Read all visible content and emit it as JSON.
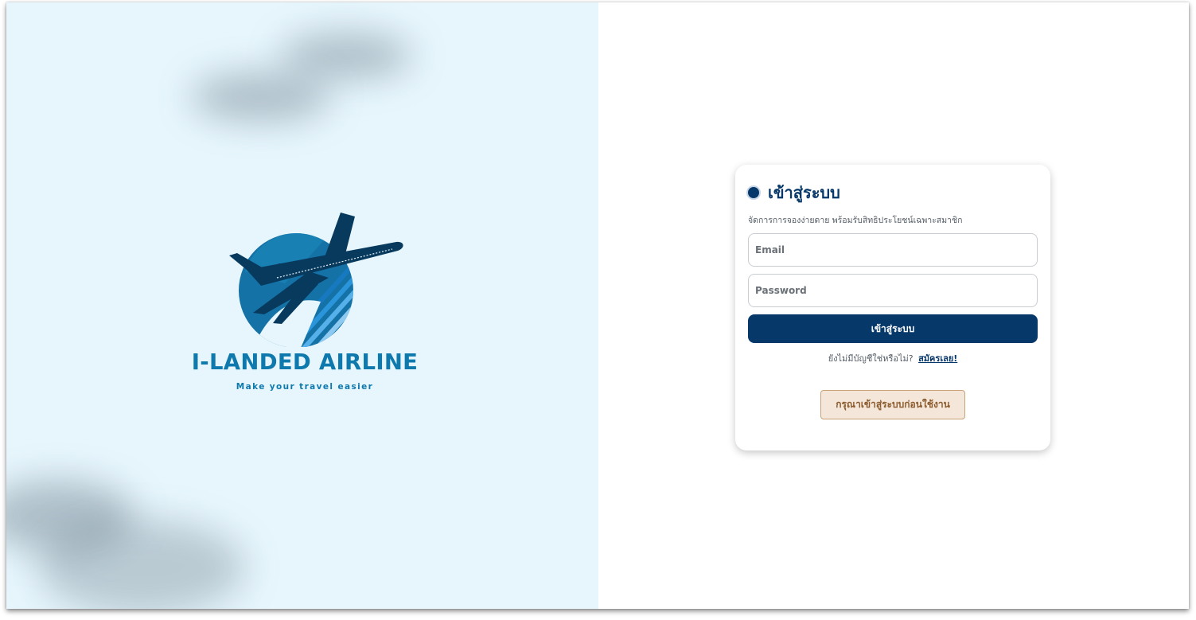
{
  "brand": {
    "name": "I-LANDED AIRLINE",
    "tagline": "Make your travel easier"
  },
  "login": {
    "title": "เข้าสู่ระบบ",
    "subtitle": "จัดการการจองง่ายดาย พร้อมรับสิทธิประโยชน์เฉพาะสมาชิก",
    "email_placeholder": "Email",
    "password_placeholder": "Password",
    "submit_label": "เข้าสู่ระบบ",
    "signup_prompt": "ยังไม่มีบัญชีใช่หรือไม่?",
    "signup_link": "สมัครเลย!",
    "notice": "กรุณาเข้าสู่ระบบก่อนใช้งาน"
  },
  "colors": {
    "primary": "#07386a",
    "brand_blue": "#0e79ad",
    "panel_bg": "#e7f6fd",
    "notice_bg": "#f4e6d8",
    "notice_text": "#8a5a2c"
  },
  "icons": {
    "logo": "airplane-logo-icon",
    "title_marker": "circle-dot-icon"
  }
}
